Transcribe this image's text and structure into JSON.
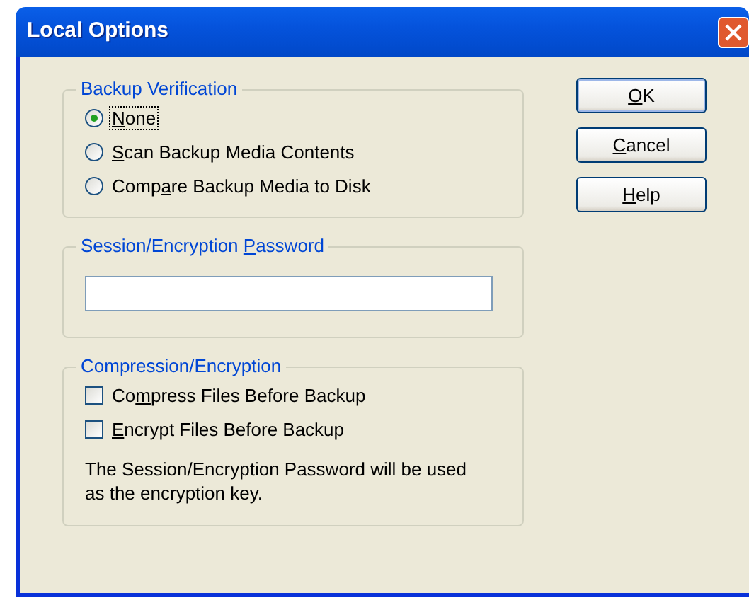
{
  "window": {
    "title": "Local Options"
  },
  "backup_verification": {
    "title": "Backup Verification",
    "options": [
      {
        "access_key": "N",
        "text_after": "one",
        "selected": true,
        "focused": true
      },
      {
        "access_key": "S",
        "text_after": "can Backup Media Contents",
        "selected": false,
        "focused": false
      },
      {
        "text_before": "Comp",
        "access_key": "a",
        "text_after": "re Backup Media to Disk",
        "selected": false,
        "focused": false
      }
    ]
  },
  "password": {
    "text_before": "Session/Encryption ",
    "access_key": "P",
    "text_after": "assword"
  },
  "compression": {
    "title": "Compression/Encryption",
    "options": [
      {
        "text_before": "Co",
        "access_key": "m",
        "text_after": "press Files Before Backup",
        "checked": false
      },
      {
        "access_key": "E",
        "text_after": "ncrypt Files Before Backup",
        "checked": false
      }
    ],
    "note": "The Session/Encryption Password will be used as the encryption key."
  },
  "buttons": [
    {
      "access_key": "O",
      "text_after": "K"
    },
    {
      "access_key": "C",
      "text_after": "ancel"
    },
    {
      "access_key": "H",
      "text_after": "elp"
    }
  ]
}
